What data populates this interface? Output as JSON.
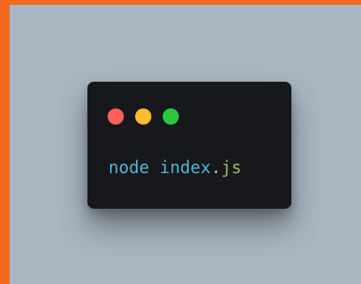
{
  "terminal": {
    "window_controls": [
      {
        "name": "close",
        "color": "#ff5f57"
      },
      {
        "name": "minimize",
        "color": "#febc2e"
      },
      {
        "name": "maximize",
        "color": "#28c840"
      }
    ],
    "command": {
      "program": "node",
      "separator": " ",
      "filename": "index",
      "dot": ".",
      "extension": "js"
    }
  },
  "colors": {
    "frame": "#f26a21",
    "background": "#a9b6c2",
    "terminal_bg": "#16181b",
    "command_text": "#4fb4d8",
    "extension_text": "#98c05c"
  }
}
